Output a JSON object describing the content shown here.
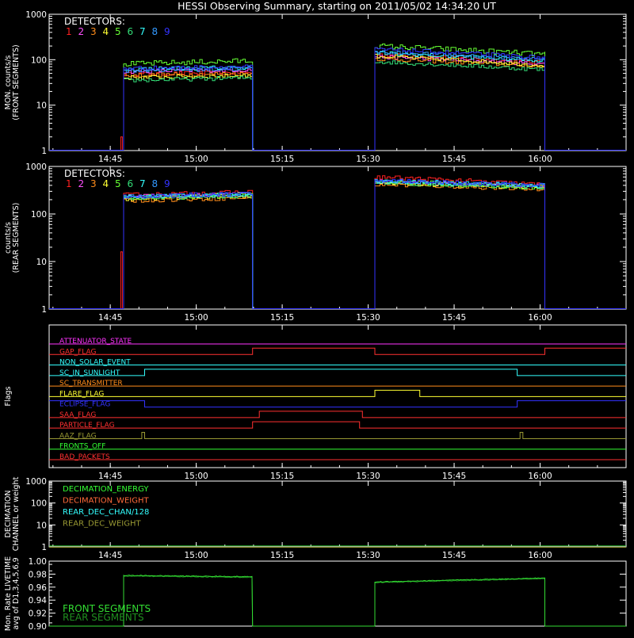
{
  "title": "HESSI Observing Summary, starting on 2011/05/02 14:34:20 UT",
  "colors": {
    "background": "#000000",
    "axis": "#ffffff",
    "detectors": [
      "#ff2020",
      "#ff50ff",
      "#ff8c1a",
      "#ffff33",
      "#66ff33",
      "#33dd77",
      "#33ffff",
      "#3399ff",
      "#3333ff"
    ]
  },
  "chart_data": [
    {
      "id": "front",
      "type": "line",
      "ylabel": [
        "MON. counts/s",
        "(FRONT SEGMENTS)"
      ],
      "yscale": "log",
      "ylim": [
        1,
        1000
      ],
      "xlim": [
        "14:34:20",
        "16:15:00"
      ],
      "xticks": [
        "14:45",
        "15:00",
        "15:15",
        "15:30",
        "15:45",
        "16:00"
      ],
      "yticks": [
        "1",
        "10",
        "100",
        "1000"
      ],
      "legend_title": "DETECTORS:",
      "legend_entries": [
        "1",
        "2",
        "3",
        "4",
        "5",
        "6",
        "7",
        "8",
        "9"
      ],
      "legend_position": "top-left",
      "grid": false,
      "segments": [
        {
          "start": "14:47:20",
          "end": "15:09:50"
        },
        {
          "start": "15:31:10",
          "end": "16:00:50"
        }
      ],
      "series": [
        {
          "name": "1",
          "seg_values": [
            [
              48,
              52
            ],
            [
              130,
              85
            ]
          ]
        },
        {
          "name": "2",
          "seg_values": [
            [
              55,
              60
            ],
            [
              115,
              80
            ]
          ]
        },
        {
          "name": "3",
          "seg_values": [
            [
              45,
              50
            ],
            [
              105,
              70
            ]
          ]
        },
        {
          "name": "4",
          "seg_values": [
            [
              40,
              45
            ],
            [
              120,
              75
            ]
          ]
        },
        {
          "name": "5",
          "seg_values": [
            [
              80,
              95
            ],
            [
              200,
              130
            ]
          ]
        },
        {
          "name": "6",
          "seg_values": [
            [
              35,
              40
            ],
            [
              90,
              60
            ]
          ]
        },
        {
          "name": "7",
          "seg_values": [
            [
              62,
              68
            ],
            [
              140,
              95
            ]
          ]
        },
        {
          "name": "8",
          "seg_values": [
            [
              58,
              63
            ],
            [
              150,
              100
            ]
          ]
        },
        {
          "name": "9",
          "seg_values": [
            [
              65,
              70
            ],
            [
              170,
              110
            ]
          ]
        }
      ],
      "spike": {
        "time": "14:46:50",
        "value": 2
      }
    },
    {
      "id": "rear",
      "type": "line",
      "ylabel": [
        "counts/s",
        "(REAR SEGMENTS)"
      ],
      "yscale": "log",
      "ylim": [
        1,
        1000
      ],
      "xlim": [
        "14:34:20",
        "16:15:00"
      ],
      "xticks": [
        "14:45",
        "15:00",
        "15:15",
        "15:30",
        "15:45",
        "16:00"
      ],
      "yticks": [
        "1",
        "10",
        "100",
        "1000"
      ],
      "legend_title": "DETECTORS:",
      "legend_entries": [
        "1",
        "2",
        "3",
        "4",
        "5",
        "6",
        "7",
        "8",
        "9"
      ],
      "legend_position": "top-left",
      "grid": false,
      "segments": [
        {
          "start": "14:47:20",
          "end": "15:09:50"
        },
        {
          "start": "15:31:10",
          "end": "16:00:50"
        }
      ],
      "series": [
        {
          "name": "1",
          "seg_values": [
            [
              250,
              290
            ],
            [
              600,
              410
            ]
          ]
        },
        {
          "name": "2",
          "seg_values": [
            [
              230,
              260
            ],
            [
              480,
              380
            ]
          ]
        },
        {
          "name": "3",
          "seg_values": [
            [
              190,
              220
            ],
            [
              420,
              330
            ]
          ]
        },
        {
          "name": "4",
          "seg_values": [
            [
              210,
              240
            ],
            [
              450,
              360
            ]
          ]
        },
        {
          "name": "5",
          "seg_values": [
            [
              220,
              250
            ],
            [
              470,
              370
            ]
          ]
        },
        {
          "name": "6",
          "seg_values": [
            [
              215,
              245
            ],
            [
              460,
              365
            ]
          ]
        },
        {
          "name": "7",
          "seg_values": [
            [
              225,
              255
            ],
            [
              490,
              390
            ]
          ]
        },
        {
          "name": "8",
          "seg_values": [
            [
              230,
              262
            ],
            [
              500,
              395
            ]
          ]
        },
        {
          "name": "9",
          "seg_values": [
            [
              235,
              265
            ],
            [
              510,
              400
            ]
          ]
        }
      ],
      "spike": {
        "time": "14:46:50",
        "value": 16
      }
    },
    {
      "id": "flags",
      "type": "line",
      "ylabel": [
        "Flags"
      ],
      "xlim": [
        "14:34:20",
        "16:15:00"
      ],
      "xticks": [
        "14:45",
        "15:00",
        "15:15",
        "15:30",
        "15:45",
        "16:00"
      ],
      "grid": false,
      "flags": [
        {
          "name": "ATTENUATOR_STATE",
          "color": "#ff33ff",
          "transitions": []
        },
        {
          "name": "GAP_FLAG",
          "color": "#ff3030",
          "transitions": [
            "15:09:50",
            "15:31:10",
            "16:00:50"
          ]
        },
        {
          "name": "NON_SOLAR_EVENT",
          "color": "#33ffff",
          "transitions": []
        },
        {
          "name": "SC_IN_SUNLIGHT",
          "color": "#33ffff",
          "transitions": [
            "14:51:00",
            "15:56:00"
          ],
          "start_high": false
        },
        {
          "name": "SC_TRANSMITTER",
          "color": "#ff8c1a",
          "transitions": []
        },
        {
          "name": "FLARE_FLAG",
          "color": "#ffff33",
          "transitions": [
            "15:31:10",
            "15:39:00"
          ]
        },
        {
          "name": "ECLIPSE_FLAG",
          "color": "#3333ff",
          "transitions": [
            "14:51:00",
            "15:56:00"
          ],
          "start_high": true
        },
        {
          "name": "SAA_FLAG",
          "color": "#ff3030",
          "transitions": [
            "15:11:00",
            "15:29:00"
          ]
        },
        {
          "name": "PARTICLE_FLAG",
          "color": "#ff3030",
          "transitions": [
            "15:09:50",
            "15:28:30"
          ]
        },
        {
          "name": "AAZ_FLAG",
          "color": "#999933",
          "transitions": [
            "14:50:30",
            "14:51:00",
            "15:56:30",
            "15:57:00"
          ]
        },
        {
          "name": "FRONTS_OFF",
          "color": "#33ff33",
          "transitions": []
        },
        {
          "name": "BAD_PACKETS",
          "color": "#ff3030",
          "transitions": []
        }
      ]
    },
    {
      "id": "decimation",
      "type": "line",
      "ylabel": [
        "DECIMATION",
        "CHANNEL or weight"
      ],
      "yscale": "log",
      "ylim": [
        1,
        1000
      ],
      "xlim": [
        "14:34:20",
        "16:15:00"
      ],
      "xticks": [
        "14:45",
        "15:00",
        "15:15",
        "15:30",
        "15:45",
        "16:00"
      ],
      "yticks": [
        "1",
        "10",
        "100",
        "1000"
      ],
      "legend_position": "top-left",
      "grid": false,
      "series": [
        {
          "name": "DECIMATION_ENERGY",
          "color": "#33ff33",
          "value": 1
        },
        {
          "name": "DECIMATION_WEIGHT",
          "color": "#ff6a3a",
          "value": 1
        },
        {
          "name": "REAR_DEC_CHAN/128",
          "color": "#33ffff",
          "value": 1
        },
        {
          "name": "REAR_DEC_WEIGHT",
          "color": "#999933",
          "value": 1
        }
      ]
    },
    {
      "id": "livetime",
      "type": "line",
      "ylabel": [
        "Mon. Rate LIVETIME",
        "avg of D1,3,4,5,6,9"
      ],
      "ylim": [
        0.9,
        1.0
      ],
      "xlim": [
        "14:34:20",
        "16:15:00"
      ],
      "yticks": [
        "0.90",
        "0.92",
        "0.94",
        "0.96",
        "0.98",
        "1.00"
      ],
      "legend_position": "bottom-left",
      "grid": false,
      "segments": [
        {
          "start": "14:47:20",
          "end": "15:09:50"
        },
        {
          "start": "15:31:10",
          "end": "16:00:50"
        }
      ],
      "series": [
        {
          "name": "FRONT SEGMENTS",
          "color": "#33dd33",
          "seg_values": [
            [
              0.978,
              0.976
            ],
            [
              0.968,
              0.974
            ]
          ]
        },
        {
          "name": "REAR SEGMENTS",
          "color": "#1f8f1f",
          "seg_values": [
            [
              0.977,
              0.975
            ],
            [
              0.967,
              0.973
            ]
          ]
        }
      ]
    }
  ]
}
